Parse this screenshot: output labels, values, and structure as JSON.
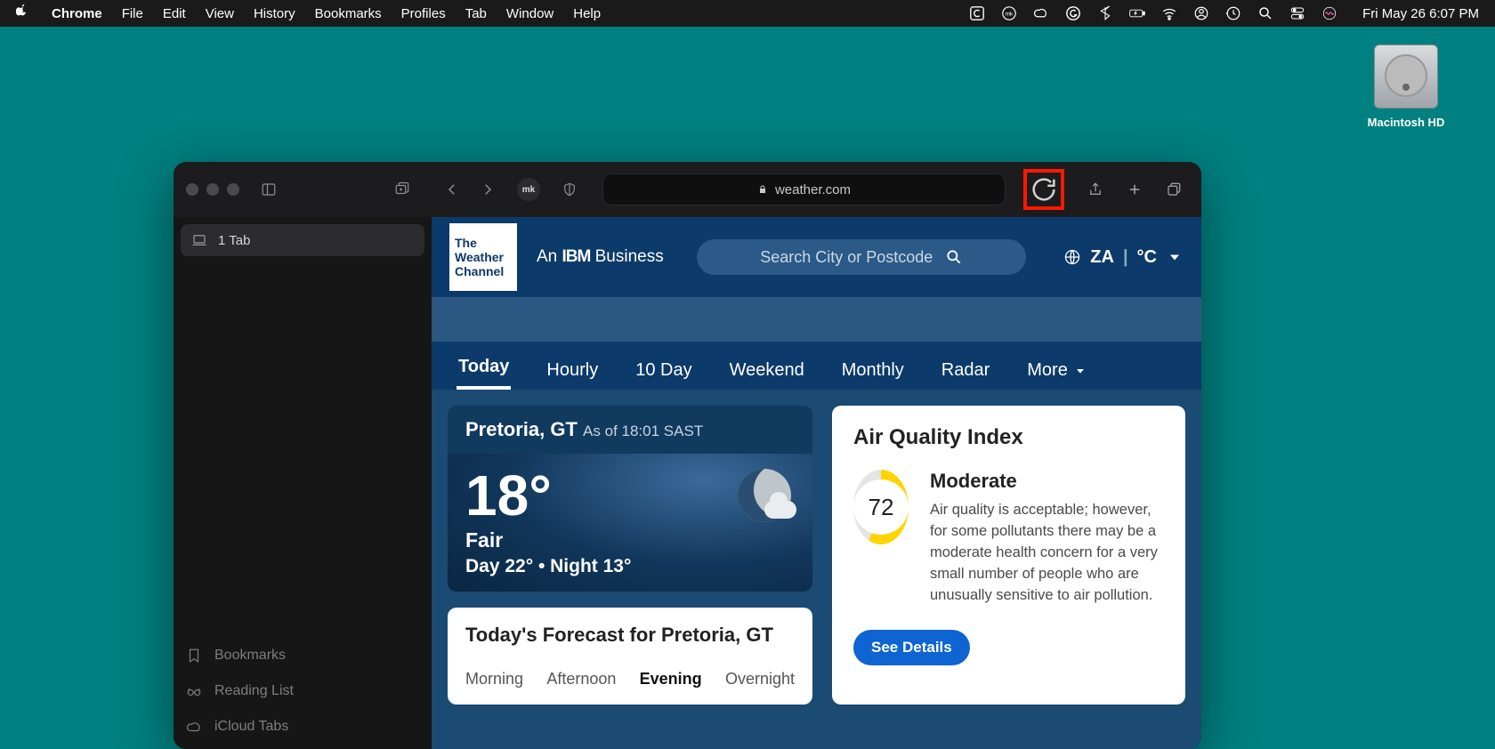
{
  "menubar": {
    "app": "Chrome",
    "items": [
      "File",
      "Edit",
      "View",
      "History",
      "Bookmarks",
      "Profiles",
      "Tab",
      "Window",
      "Help"
    ],
    "clock": "Fri May 26  6:07 PM"
  },
  "desktop": {
    "hdd_label": "Macintosh HD"
  },
  "browser": {
    "tab_count_label": "1 Tab",
    "address": "weather.com",
    "sidebar_links": {
      "bookmarks": "Bookmarks",
      "reading": "Reading List",
      "icloud": "iCloud Tabs"
    }
  },
  "weather": {
    "logo_lines": [
      "The",
      "Weather",
      "Channel"
    ],
    "tagline_prefix": "An ",
    "tagline_ibm": "IBM",
    "tagline_suffix": " Business",
    "search_placeholder": "Search City or Postcode",
    "locale_country": "ZA",
    "locale_unit": "°C",
    "nav": [
      "Today",
      "Hourly",
      "10 Day",
      "Weekend",
      "Monthly",
      "Radar",
      "More"
    ],
    "current": {
      "location": "Pretoria, GT",
      "asof": "As of 18:01 SAST",
      "temp": "18°",
      "condition": "Fair",
      "range": "Day 22° • Night 13°"
    },
    "forecast_card": {
      "title": "Today's Forecast for Pretoria, GT",
      "parts": [
        "Morning",
        "Afternoon",
        "Evening",
        "Overnight"
      ],
      "active_part": "Evening"
    },
    "aqi": {
      "title": "Air Quality Index",
      "value": "72",
      "level": "Moderate",
      "desc": "Air quality is acceptable; however, for some pollutants there may be a moderate health concern for a very small number of people who are unusually sensitive to air pollution.",
      "button": "See Details"
    }
  }
}
